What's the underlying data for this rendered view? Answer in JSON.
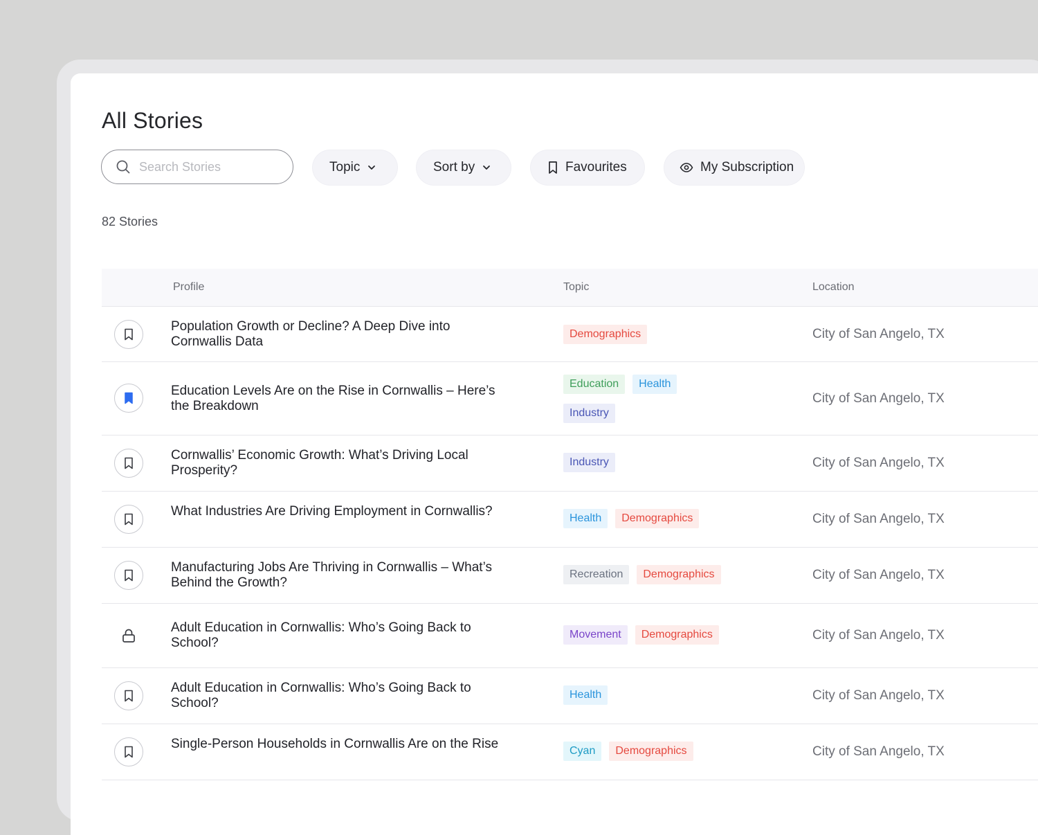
{
  "page": {
    "title": "All Stories",
    "search_placeholder": "Search Stories",
    "count_text": "82 Stories"
  },
  "toolbar": {
    "topic_label": "Topic",
    "sort_label": "Sort by",
    "favourites_label": "Favourites",
    "subscription_label": "My Subscription"
  },
  "table": {
    "headers": {
      "profile": "Profile",
      "topic": "Topic",
      "location": "Location"
    },
    "rows": [
      {
        "title": "Population Growth or Decline? A Deep Dive into Cornwallis Data",
        "marker": "bookmark",
        "tags": [
          "Demographics"
        ],
        "location": "City of San Angelo, TX"
      },
      {
        "title": "Education Levels Are on the Rise in Cornwallis – Here’s the Breakdown",
        "marker": "bookmark-filled",
        "tags": [
          "Education",
          "Health",
          "Industry"
        ],
        "location": "City of San Angelo, TX"
      },
      {
        "title": "Cornwallis’ Economic Growth: What’s Driving Local Prosperity?",
        "marker": "bookmark",
        "tags": [
          "Industry"
        ],
        "location": "City of San Angelo, TX"
      },
      {
        "title": "What Industries Are Driving Employment in Cornwallis?",
        "marker": "bookmark",
        "tags": [
          "Health",
          "Demographics"
        ],
        "location": "City of San Angelo, TX"
      },
      {
        "title": "Manufacturing Jobs Are Thriving in Cornwallis – What’s Behind the Growth?",
        "marker": "bookmark",
        "tags": [
          "Recreation",
          "Demographics"
        ],
        "location": "City of San Angelo, TX"
      },
      {
        "title": "Adult Education in Cornwallis: Who’s Going Back to School?",
        "marker": "lock",
        "tags": [
          "Movement",
          "Demographics"
        ],
        "location": "City of San Angelo, TX"
      },
      {
        "title": "Adult Education in Cornwallis: Who’s Going Back to School?",
        "marker": "bookmark",
        "tags": [
          "Health"
        ],
        "location": "City of San Angelo, TX"
      },
      {
        "title": "Single-Person Households in Cornwallis Are on the Rise",
        "marker": "bookmark",
        "tags": [
          "Cyan",
          "Demographics"
        ],
        "location": "City of San Angelo, TX"
      }
    ]
  },
  "tag_colors": {
    "Demographics": {
      "bg": "#fdecea",
      "fg": "#e5493f"
    },
    "Education": {
      "bg": "#e9f6ec",
      "fg": "#3f9e5a"
    },
    "Health": {
      "bg": "#e6f4fd",
      "fg": "#2a94dc"
    },
    "Industry": {
      "bg": "#ebedf9",
      "fg": "#4a56b5"
    },
    "Recreation": {
      "bg": "#eef0f3",
      "fg": "#6b7280"
    },
    "Movement": {
      "bg": "#f0ebfa",
      "fg": "#7a45c9"
    },
    "Cyan": {
      "bg": "#e3f6fb",
      "fg": "#1d9bc4"
    }
  },
  "colors": {
    "accent": "#2d6cf0"
  }
}
